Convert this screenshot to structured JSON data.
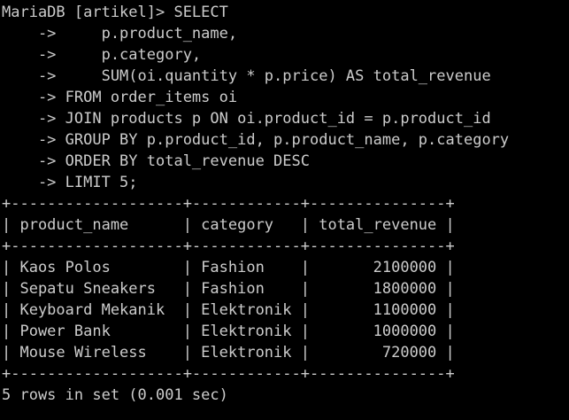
{
  "terminal": {
    "fg_color": "#cccccc",
    "bg_color": "#000000",
    "query_lines": [
      "MariaDB [artikel]> SELECT",
      "    ->     p.product_name,",
      "    ->     p.category,",
      "    ->     SUM(oi.quantity * p.price) AS total_revenue",
      "    -> FROM order_items oi",
      "    -> JOIN products p ON oi.product_id = p.product_id",
      "    -> GROUP BY p.product_id, p.product_name, p.category",
      "    -> ORDER BY total_revenue DESC",
      "    -> LIMIT 5;"
    ],
    "result_table": {
      "border_top": "+-------------------+------------+---------------+",
      "header": "| product_name      | category   | total_revenue |",
      "border_mid": "+-------------------+------------+---------------+",
      "rows": [
        "| Kaos Polos        | Fashion    |       2100000 |",
        "| Sepatu Sneakers   | Fashion    |       1800000 |",
        "| Keyboard Mekanik  | Elektronik |       1100000 |",
        "| Power Bank        | Elektronik |       1000000 |",
        "| Mouse Wireless    | Elektronik |        720000 |"
      ],
      "border_bottom": "+-------------------+------------+---------------+"
    },
    "status_line": "5 rows in set (0.001 sec)"
  }
}
